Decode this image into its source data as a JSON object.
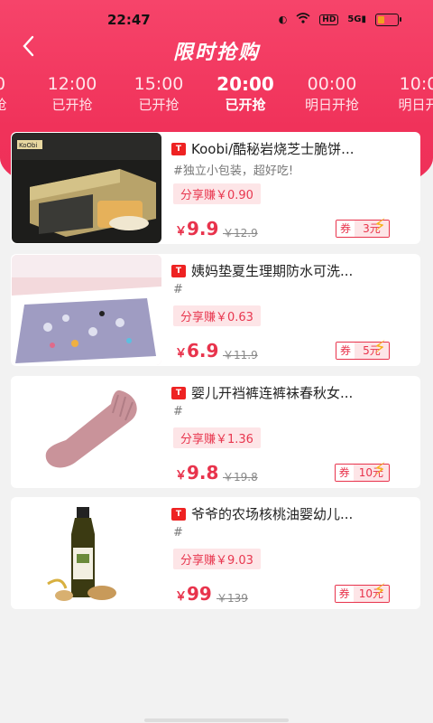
{
  "status": {
    "time": "22:47",
    "hd": "HD",
    "net": "5G"
  },
  "nav": {
    "title": "限时抢购"
  },
  "tabs": [
    {
      "time": "0",
      "status": "抢",
      "active": false
    },
    {
      "time": "12:00",
      "status": "已开抢",
      "active": false
    },
    {
      "time": "15:00",
      "status": "已开抢",
      "active": false
    },
    {
      "time": "20:00",
      "status": "已开抢",
      "active": true
    },
    {
      "time": "00:00",
      "status": "明日开抢",
      "active": false
    },
    {
      "time": "10:0",
      "status": "明日开",
      "active": false
    }
  ],
  "products": [
    {
      "title": "Koobi/酷秘岩烧芝士脆饼...",
      "desc": "#独立小包装，超好吃!",
      "share": "分享赚￥0.90",
      "currency": "￥",
      "price": "9.9",
      "orig": "￥12.9",
      "coupon_label": "券",
      "coupon_value": "3元",
      "image": "biscuit-gift-box"
    },
    {
      "title": "姨妈垫夏生理期防水可洗...",
      "desc": "#",
      "share": "分享赚￥0.63",
      "currency": "￥",
      "price": "6.9",
      "orig": "￥11.9",
      "coupon_label": "券",
      "coupon_value": "5元",
      "image": "bed-pad"
    },
    {
      "title": "婴儿开裆裤连裤袜春秋女...",
      "desc": "#",
      "share": "分享赚￥1.36",
      "currency": "￥",
      "price": "9.8",
      "orig": "￥19.8",
      "coupon_label": "券",
      "coupon_value": "10元",
      "image": "pink-tights"
    },
    {
      "title": "爷爷的农场核桃油婴幼儿...",
      "desc": "#",
      "share": "分享赚￥9.03",
      "currency": "￥",
      "price": "99",
      "orig": "￥139",
      "coupon_label": "券",
      "coupon_value": "10元",
      "image": "walnut-oil-bottle"
    }
  ],
  "colors": {
    "brand": "#f0325a",
    "price": "#e8334c",
    "bolt": "#f6b11c"
  }
}
